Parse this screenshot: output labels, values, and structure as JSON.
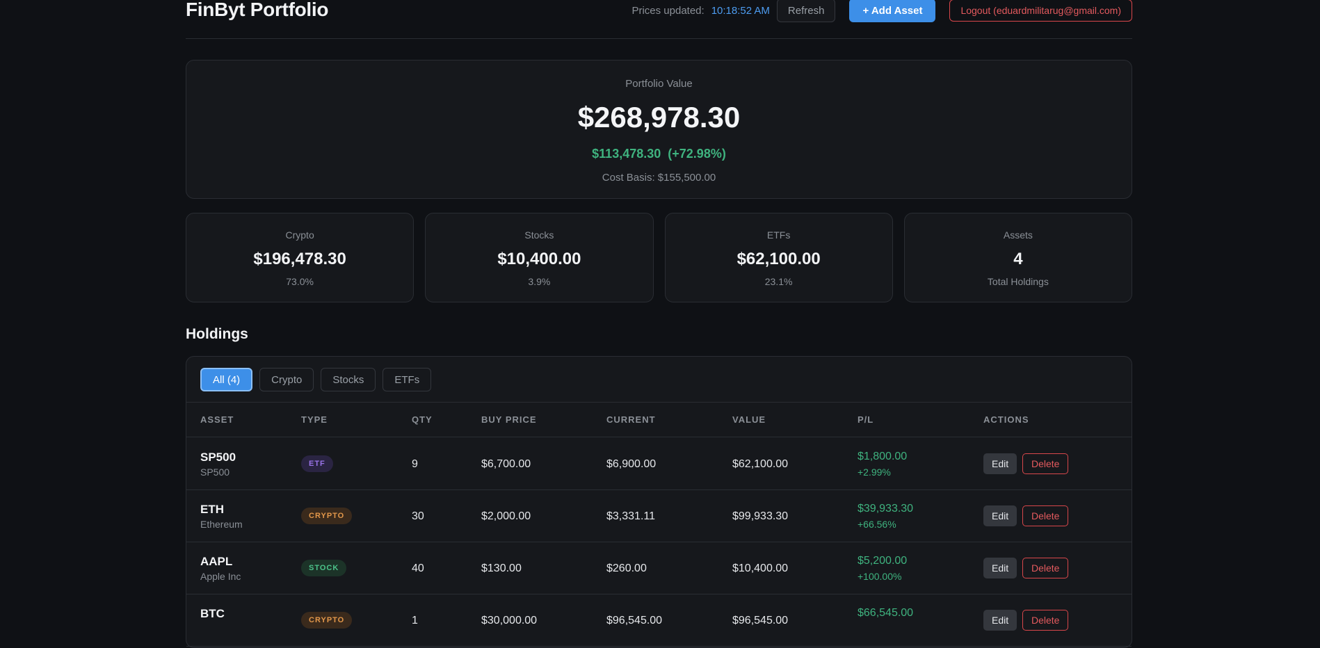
{
  "header": {
    "title": "FinByt Portfolio",
    "prices_updated_label": "Prices updated:",
    "prices_updated_time": "10:18:52 AM",
    "refresh_label": "Refresh",
    "add_asset_label": "+ Add Asset",
    "logout_label": "Logout (eduardmilitarug@gmail.com)"
  },
  "portfolio": {
    "label": "Portfolio Value",
    "value": "$268,978.30",
    "change": "$113,478.30",
    "change_pct": "(+72.98%)",
    "cost_basis": "Cost Basis: $155,500.00"
  },
  "stats": [
    {
      "label": "Crypto",
      "value": "$196,478.30",
      "sub": "73.0%"
    },
    {
      "label": "Stocks",
      "value": "$10,400.00",
      "sub": "3.9%"
    },
    {
      "label": "ETFs",
      "value": "$62,100.00",
      "sub": "23.1%"
    },
    {
      "label": "Assets",
      "value": "4",
      "sub": "Total Holdings"
    }
  ],
  "holdings": {
    "title": "Holdings",
    "filters": [
      "All (4)",
      "Crypto",
      "Stocks",
      "ETFs"
    ],
    "columns": [
      "ASSET",
      "TYPE",
      "QTY",
      "BUY PRICE",
      "CURRENT",
      "VALUE",
      "P/L",
      "ACTIONS"
    ],
    "edit_label": "Edit",
    "delete_label": "Delete",
    "rows": [
      {
        "symbol": "SP500",
        "name": "SP500",
        "type": "ETF",
        "qty": "9",
        "buy": "$6,700.00",
        "current": "$6,900.00",
        "value": "$62,100.00",
        "pl": "$1,800.00",
        "pl_pct": "+2.99%"
      },
      {
        "symbol": "ETH",
        "name": "Ethereum",
        "type": "CRYPTO",
        "qty": "30",
        "buy": "$2,000.00",
        "current": "$3,331.11",
        "value": "$99,933.30",
        "pl": "$39,933.30",
        "pl_pct": "+66.56%"
      },
      {
        "symbol": "AAPL",
        "name": "Apple Inc",
        "type": "STOCK",
        "qty": "40",
        "buy": "$130.00",
        "current": "$260.00",
        "value": "$10,400.00",
        "pl": "$5,200.00",
        "pl_pct": "+100.00%"
      },
      {
        "symbol": "BTC",
        "name": "",
        "type": "CRYPTO",
        "qty": "1",
        "buy": "$30,000.00",
        "current": "$96,545.00",
        "value": "$96,545.00",
        "pl": "$66,545.00",
        "pl_pct": ""
      }
    ]
  },
  "colors": {
    "background": "#0f1115",
    "accent": "#3d8fe8",
    "positive": "#3fb37f",
    "danger": "#e45a5e"
  }
}
